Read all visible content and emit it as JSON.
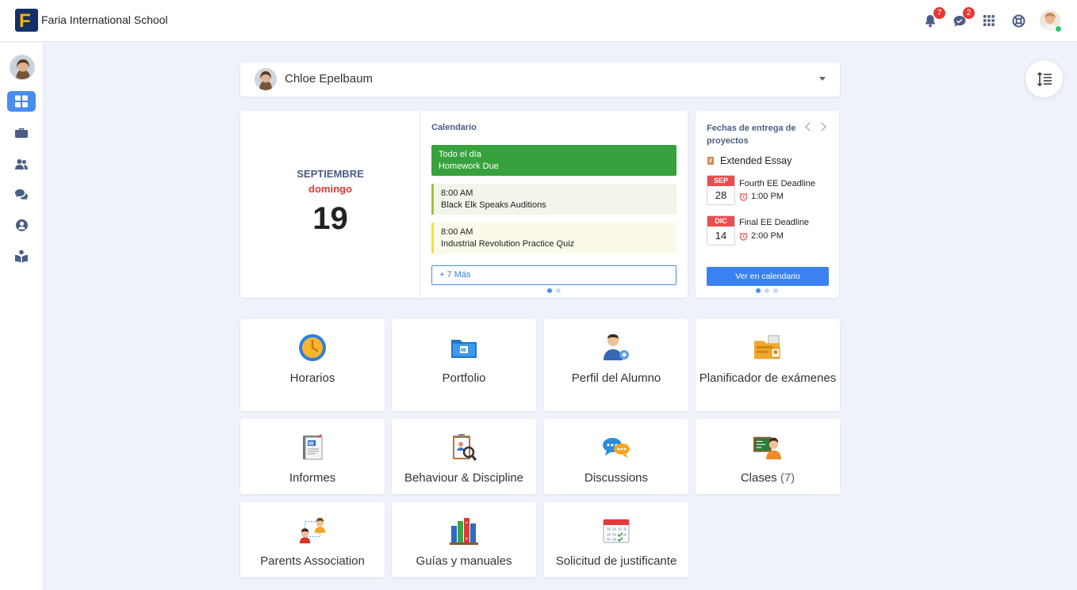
{
  "app": {
    "school_name": "Faria International School",
    "logo_letter": "F"
  },
  "topbar": {
    "notifications_count": "7",
    "messages_count": "2"
  },
  "student": {
    "name": "Chloe Epelbaum"
  },
  "today": {
    "month": "SEPTIEMBRE",
    "weekday": "domingo",
    "day": "19"
  },
  "calendar": {
    "title": "Calendario",
    "events": [
      {
        "time": "Todo el día",
        "title": "Homework Due"
      },
      {
        "time": "8:00 AM",
        "title": "Black Elk Speaks Auditions"
      },
      {
        "time": "8:00 AM",
        "title": "Industrial Revolution Practice Quiz"
      }
    ],
    "more_label": "+ 7 Más"
  },
  "deadlines": {
    "title": "Fechas de entrega de proyectos",
    "project": "Extended Essay",
    "items": [
      {
        "month": "SEP",
        "day": "28",
        "name": "Fourth EE Deadline",
        "time": "1:00 PM"
      },
      {
        "month": "DIC",
        "day": "14",
        "name": "Final EE Deadline",
        "time": "2:00 PM"
      }
    ],
    "button_label": "Ver en calendario"
  },
  "tiles": [
    {
      "label": "Horarios",
      "icon": "clock-icon"
    },
    {
      "label": "Portfolio",
      "icon": "portfolio-folder-icon"
    },
    {
      "label": "Perfil del Alumno",
      "icon": "student-profile-icon"
    },
    {
      "label": "Planificador de exámenes",
      "icon": "exam-planner-icon"
    },
    {
      "label": "Informes",
      "icon": "report-cards-icon"
    },
    {
      "label": "Behaviour & Discipline",
      "icon": "behaviour-clipboard-icon"
    },
    {
      "label": "Discussions",
      "icon": "discussion-bubbles-icon"
    },
    {
      "label": "Clases",
      "count": "(7)",
      "icon": "classes-icon"
    },
    {
      "label": "Parents Association",
      "icon": "parents-association-icon"
    },
    {
      "label": "Guías y manuales",
      "icon": "guides-books-icon"
    },
    {
      "label": "Solicitud de justificante",
      "icon": "absence-request-calendar-icon"
    }
  ],
  "colors": {
    "accent": "#4a8cf0",
    "all_day_event": "#37a23d",
    "weekday": "#e53935",
    "badge": "#e53935"
  }
}
